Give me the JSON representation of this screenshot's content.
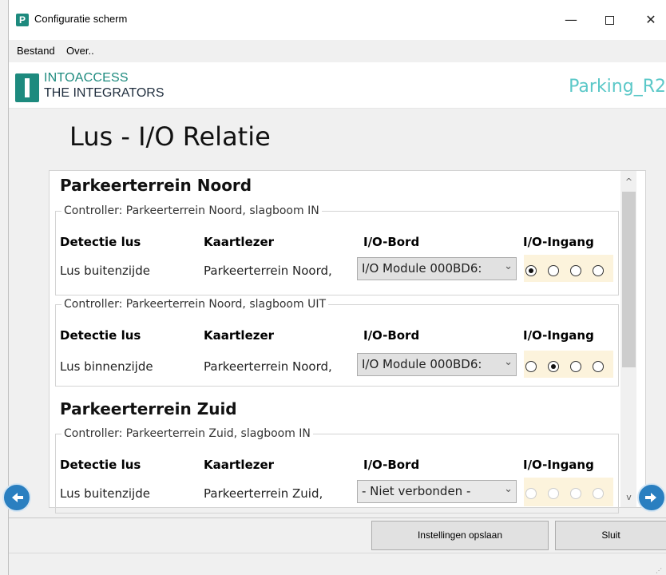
{
  "window": {
    "title": "Configuratie scherm",
    "app_icon_letter": "P",
    "controls": {
      "minimize": "—",
      "close": "✕"
    }
  },
  "menu": [
    "Bestand",
    "Over.."
  ],
  "header": {
    "logo_line1": "INTOACCESS",
    "logo_line2": "THE INTEGRATORS",
    "station": "Parking_R2"
  },
  "page_title": "Lus - I/O Relatie",
  "columns": {
    "loop": "Detectie lus",
    "reader": "Kaartlezer",
    "board": "I/O-Bord",
    "input": "I/O-Ingang"
  },
  "lots": [
    {
      "name": "Parkeerterrein Noord",
      "controllers": [
        {
          "legend": "Controller: Parkeerterrein Noord, slagboom IN",
          "loop": "Lus buitenzijde",
          "reader": "Parkeerterrein Noord,",
          "board": "I/O Module 000BD6:",
          "selected_input": 1,
          "enabled": true
        },
        {
          "legend": "Controller: Parkeerterrein Noord, slagboom UIT",
          "loop": "Lus binnenzijde",
          "reader": "Parkeerterrein Noord,",
          "board": "I/O Module 000BD6:",
          "selected_input": 2,
          "enabled": true
        }
      ]
    },
    {
      "name": "Parkeerterrein Zuid",
      "controllers": [
        {
          "legend": "Controller: Parkeerterrein Zuid, slagboom IN",
          "loop": "Lus buitenzijde",
          "reader": "Parkeerterrein Zuid,",
          "board": "- Niet verbonden -",
          "selected_input": 0,
          "enabled": false
        }
      ]
    }
  ],
  "scroll": {
    "up": "^",
    "down": "v"
  },
  "buttons": {
    "save": "Instellingen opslaan",
    "close": "Sluit"
  },
  "colors": {
    "brand_teal": "#1d8a7e",
    "station_text": "#5bc8c8",
    "nav_blue": "#2a7fc0",
    "io_highlight": "#fcf3dc"
  }
}
